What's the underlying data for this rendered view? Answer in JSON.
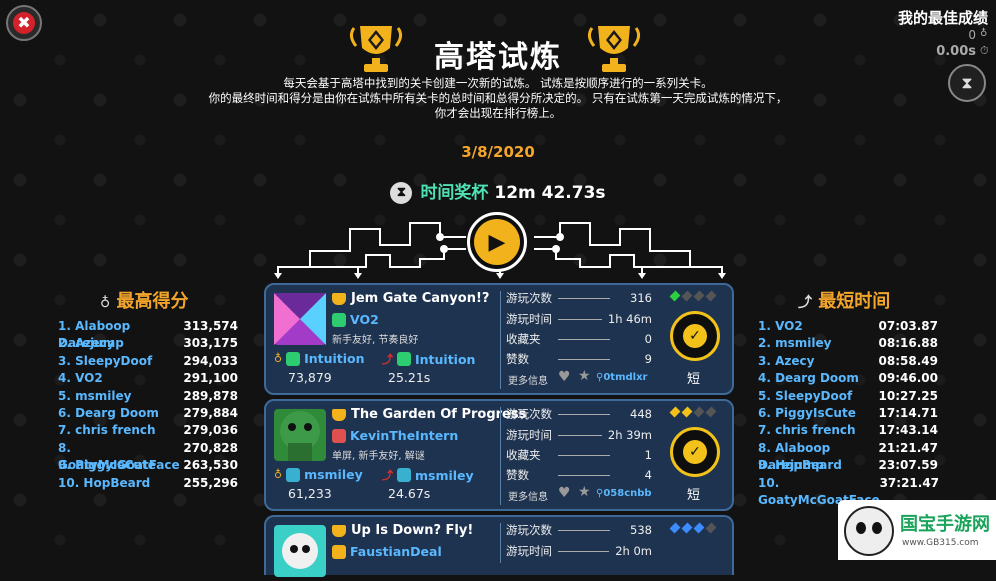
{
  "header": {
    "title": "高塔试炼",
    "desc_line1": "每天会基于高塔中找到的关卡创建一次新的试炼。 试炼是按顺序进行的一系列关卡。",
    "desc_line2": "你的最终时间和得分是由你在试炼中所有关卡的总时间和总得分所决定的。 只有在试炼第一天完成试炼的情况下，",
    "desc_line3": "你才会出现在排行榜上。",
    "date": "3/8/2020",
    "time_trophy_label": "时间奖杯",
    "time_trophy_value": "12m 42.73s"
  },
  "best": {
    "label": "我的最佳成绩",
    "score": "0",
    "time": "0.00s"
  },
  "icons": {
    "close": "close-icon",
    "hourglass": "hourglass-icon",
    "trophy": "trophy-icon",
    "medal": "medal-icon",
    "boot": "boot-icon",
    "heart": "heart-icon",
    "star": "star-icon",
    "link": "link-icon",
    "play": "play-icon"
  },
  "high_score": {
    "title": "最高得分",
    "entries": [
      {
        "name": "1. Alaboop Darejump",
        "value": "313,574"
      },
      {
        "name": "2. Azecy",
        "value": "303,175"
      },
      {
        "name": "3. SleepyDoof",
        "value": "294,033"
      },
      {
        "name": "4. VO2",
        "value": "291,100"
      },
      {
        "name": "5. msmiley",
        "value": "289,878"
      },
      {
        "name": "6. Dearg Doom",
        "value": "279,884"
      },
      {
        "name": "7. chris french",
        "value": "279,036"
      },
      {
        "name": "8. GoatyMcGoatFace",
        "value": "270,828"
      },
      {
        "name": "9. PiggyIsCute",
        "value": "263,530"
      },
      {
        "name": "10. HopBeard",
        "value": "255,296"
      }
    ]
  },
  "shortest_time": {
    "title": "最短时间",
    "entries": [
      {
        "name": "1. VO2",
        "value": "07:03.87"
      },
      {
        "name": "2. msmiley",
        "value": "08:16.88"
      },
      {
        "name": "3. Azecy",
        "value": "08:58.49"
      },
      {
        "name": "4. Dearg Doom",
        "value": "09:46.00"
      },
      {
        "name": "5. SleepyDoof",
        "value": "10:27.25"
      },
      {
        "name": "6. PiggyIsCute",
        "value": "17:14.71"
      },
      {
        "name": "7. chris french",
        "value": "17:43.14"
      },
      {
        "name": "8. Alaboop Darejump",
        "value": "21:21.47"
      },
      {
        "name": "9. HopBeard",
        "value": "23:07.59"
      },
      {
        "name": "10. GoatyMcGoatFace",
        "value": "37:21.47"
      }
    ]
  },
  "stat_labels": {
    "plays": "游玩次数",
    "playtime": "游玩时间",
    "favorites": "收藏夹",
    "likes": "赞数",
    "more": "更多信息"
  },
  "levels": [
    {
      "title": "Jem Gate Canyon!?",
      "maker": "VO2",
      "tags": "新手友好, 节奏良好",
      "score_holder": "Intuition",
      "score": "73,879",
      "time_holder": "Intuition",
      "time": "25.21s",
      "plays": "316",
      "playtime": "1h 46m",
      "favorites": "0",
      "likes": "9",
      "code": "0tmdlxr",
      "length": "短",
      "thumb_color": "#a23cc8",
      "diamond_color": "#2ecc40"
    },
    {
      "title": "The Garden Of Progress",
      "maker": "KevinTheIntern",
      "tags": "单屏, 新手友好, 解谜",
      "score_holder": "msmiley",
      "score": "61,233",
      "time_holder": "msmiley",
      "time": "24.67s",
      "plays": "448",
      "playtime": "2h 39m",
      "favorites": "1",
      "likes": "4",
      "code": "058cnbb",
      "length": "短",
      "thumb_color": "#2f8a3a",
      "diamond_color": "#f2c21b"
    },
    {
      "title": "Up Is Down? Fly!",
      "maker": "FaustianDeal",
      "plays": "538",
      "playtime": "2h 0m",
      "thumb_color": "#3ad0c8",
      "diamond_color": "#3a8cff"
    }
  ],
  "watermark": {
    "text": "国宝手游网",
    "url": "www.GB315.com"
  }
}
